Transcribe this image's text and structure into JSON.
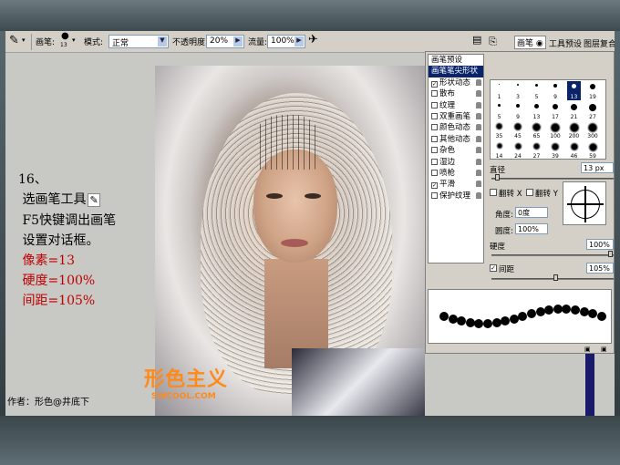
{
  "options_bar": {
    "brush_label": "画笔:",
    "brush_size": "13",
    "mode_label": "模式:",
    "mode_value": "正常",
    "opacity_label": "不透明度:",
    "opacity_value": "20%",
    "flow_label": "流量:",
    "flow_value": "100%"
  },
  "panel_tabs": {
    "brushes": "画笔",
    "tool_presets": "工具预设",
    "layer_comps": "图层复合"
  },
  "brush_panel": {
    "list": [
      {
        "label": "画笔预设",
        "check": false,
        "selected": false,
        "lock": false,
        "checkbox": false
      },
      {
        "label": "画笔笔尖形状",
        "check": false,
        "selected": true,
        "lock": false,
        "checkbox": false
      },
      {
        "label": "形状动态",
        "check": true,
        "selected": false,
        "lock": true,
        "checkbox": true
      },
      {
        "label": "散布",
        "check": false,
        "selected": false,
        "lock": true,
        "checkbox": true
      },
      {
        "label": "纹理",
        "check": false,
        "selected": false,
        "lock": true,
        "checkbox": true
      },
      {
        "label": "双重画笔",
        "check": false,
        "selected": false,
        "lock": true,
        "checkbox": true
      },
      {
        "label": "颜色动态",
        "check": false,
        "selected": false,
        "lock": true,
        "checkbox": true
      },
      {
        "label": "其他动态",
        "check": false,
        "selected": false,
        "lock": true,
        "checkbox": true
      },
      {
        "label": "杂色",
        "check": false,
        "selected": false,
        "lock": true,
        "checkbox": true
      },
      {
        "label": "湿边",
        "check": false,
        "selected": false,
        "lock": true,
        "checkbox": true
      },
      {
        "label": "喷枪",
        "check": false,
        "selected": false,
        "lock": true,
        "checkbox": true
      },
      {
        "label": "平滑",
        "check": true,
        "selected": false,
        "lock": true,
        "checkbox": true
      },
      {
        "label": "保护纹理",
        "check": false,
        "selected": false,
        "lock": true,
        "checkbox": true
      }
    ],
    "tip_sizes": [
      "1",
      "3",
      "5",
      "9",
      "13",
      "19",
      "5",
      "9",
      "13",
      "17",
      "21",
      "27",
      "35",
      "45",
      "65",
      "100",
      "200",
      "300",
      "14",
      "24",
      "27",
      "39",
      "46",
      "59"
    ],
    "selected_tip": "13",
    "diameter_label": "直径",
    "diameter_value": "13 px",
    "flip_x_label": "翻转 X",
    "flip_y_label": "翻转 Y",
    "angle_label": "角度:",
    "angle_value": "0度",
    "roundness_label": "圆度:",
    "roundness_value": "100%",
    "hardness_label": "硬度",
    "hardness_value": "100%",
    "spacing_label": "间距",
    "spacing_value": "105%",
    "spacing_checked": true
  },
  "tutorial": {
    "step_no": "16、",
    "line1": "选画笔工具",
    "line2": "F5快键调出画笔",
    "line3": "设置对话框。",
    "pixel": "像素=13",
    "hardness": "硬度=100%",
    "spacing": "间距=105%"
  },
  "author": "作者：形色@井底下",
  "watermark": {
    "text": "形色主义",
    "url": "SWCOOL.COM"
  }
}
